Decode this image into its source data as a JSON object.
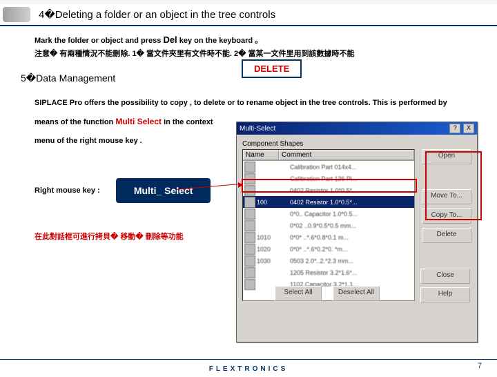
{
  "section4": {
    "title": "4�Deleting a folder or an object in the tree controls",
    "line1a": "Mark the folder or object and press ",
    "del": "Del",
    "line1b": " key on the keyboard 。",
    "note": "注意� 有兩種情況不能刪除. 1� 當文件夾里有文件時不能. 2� 當某一文件里用到該數據時不能",
    "deleteBtn": "DELETE"
  },
  "section5": {
    "title": "5�Data Management",
    "body1": "SIPLACE Pro offers the possibility to copy , to delete or to rename object in the tree controls. This is performed by",
    "body2a": "means of the function ",
    "multi": "Multi Select",
    "body2b": " in the context",
    "body3": "menu of the right  mouse key .",
    "rightKey": "Right mouse key :",
    "multiBtn": "Multi_ Select",
    "cnNote": "在此對話框可進行拷貝� 移動� 刪除等功能"
  },
  "dialog": {
    "title": "Multi-Select",
    "helpIcon": "?",
    "closeIcon": "X",
    "group": "Component Shapes",
    "cols": [
      "Name",
      "Comment"
    ],
    "rows": [
      {
        "n": "",
        "c": "Calibration Part 014x4..."
      },
      {
        "n": "",
        "c": "Calibration Part 136 Pi..."
      },
      {
        "n": "",
        "c": "0402 Resistor 1.0*0.5*..."
      },
      {
        "n": "100",
        "c": "0402 Resistor 1.0*0.5*..."
      },
      {
        "n": "",
        "c": "0*0.. Capacitor 1.0*0.5..."
      },
      {
        "n": "",
        "c": "0*02 ..0.9*0.5*0.5 mm..."
      },
      {
        "n": "1010",
        "c": "0*0* ..*.6*0.8*0.1 m..."
      },
      {
        "n": "1020",
        "c": "0*0* ..*.6*0.2*0. *m..."
      },
      {
        "n": "1030",
        "c": "0503 2.0*..2.*2.3 mm..."
      },
      {
        "n": "",
        "c": "1205 Resistor 3.2*1.6*..."
      },
      {
        "n": "",
        "c": "1102 Capacitor 3.2*1.1..."
      }
    ],
    "btns": {
      "open": "Open",
      "move": "Move To...",
      "copy": "Copy To...",
      "delete": "Delete",
      "close": "Close",
      "help": "Help",
      "selectAll": "Select All",
      "deselectAll": "Deselect All"
    }
  },
  "footer": {
    "brand": "FLEXTRONICS",
    "page": "7"
  }
}
